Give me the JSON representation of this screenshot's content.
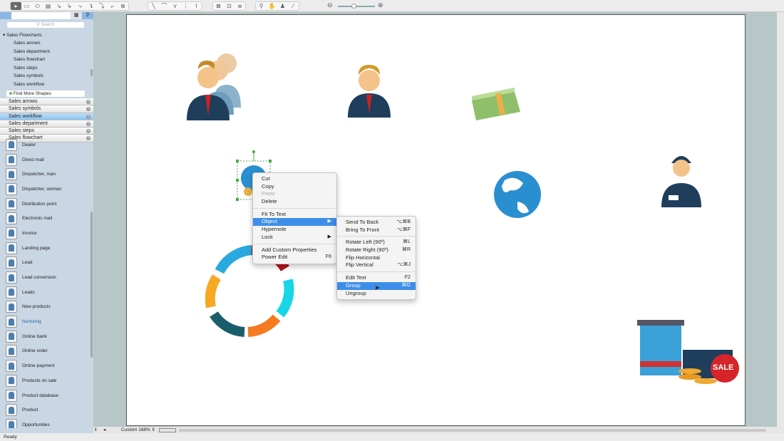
{
  "toolbar": {
    "zoom_out_icon": "zoom-out-icon",
    "zoom_in_icon": "zoom-in-icon"
  },
  "sidebar": {
    "search_placeholder": "Search",
    "tree_header": "Sales Flowcharts",
    "tree_items": [
      "Sales arrows",
      "Sales department",
      "Sales flowchart",
      "Sales steps",
      "Sales symbols",
      "Sales workflow"
    ],
    "find_more": "Find More Shapes",
    "libraries": [
      "Sales arrows",
      "Sales symbols",
      "Sales workflow",
      "Sales department",
      "Sales steps",
      "Sales flowchart"
    ],
    "selected_library": "Sales workflow",
    "shapes": [
      "Dealer",
      "Direct mail",
      "Dispatcher, man",
      "Dispatcher, woman",
      "Distribution point",
      "Electronic mail",
      "Invoice",
      "Landing page",
      "Lead",
      "Lead conversion",
      "Leads",
      "New products",
      "Nurturing",
      "Online bank",
      "Online order",
      "Online payment",
      "Products on sale",
      "Product database",
      "Product",
      "Opportunities"
    ]
  },
  "context_menu": {
    "items": [
      "Cut",
      "Copy",
      "Paste",
      "Delete",
      "Fit To Text",
      "Object",
      "Hypernote",
      "Lock",
      "Add Custom Properties",
      "Power Edit"
    ],
    "power_edit_shortcut": "F6"
  },
  "submenu": {
    "send_to_back": "Send To Back",
    "send_to_back_sc": "⌥⌘B",
    "bring_to_front": "Bring To Front",
    "bring_to_front_sc": "⌥⌘F",
    "rotate_left": "Rotate Left (90º)",
    "rotate_left_sc": "⌘L",
    "rotate_right": "Rotate Right (90º)",
    "rotate_right_sc": "⌘R",
    "flip_h": "Flip Horizontal",
    "flip_v": "Flip Vertical",
    "flip_v_sc": "⌥⌘J",
    "edit_text": "Edit Text",
    "edit_text_sc": "F2",
    "group": "Group",
    "group_sc": "⌘G",
    "ungroup": "Ungroup"
  },
  "bottom": {
    "zoom_label": "Custom 168%"
  },
  "status": "Ready",
  "canvas": {
    "sale_badge": "SALE"
  }
}
